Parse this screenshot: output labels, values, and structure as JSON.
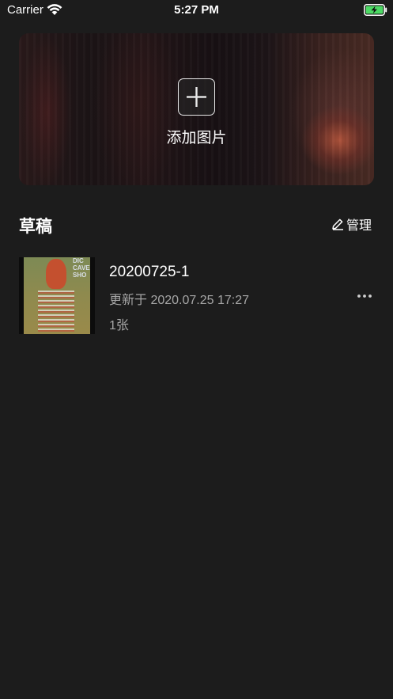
{
  "status_bar": {
    "carrier": "Carrier",
    "time": "5:27 PM",
    "battery_color": "#4cd964"
  },
  "hero": {
    "add_label": "添加图片",
    "add_icon": "plus-icon"
  },
  "drafts_section": {
    "title": "草稿",
    "manage_label": "管理",
    "manage_icon": "pencil-icon"
  },
  "drafts": [
    {
      "name": "20200725-1",
      "updated": "更新于 2020.07.25 17:27",
      "count": "1张",
      "thumbnail_text": "DIC CAVE SHO"
    }
  ],
  "colors": {
    "background": "#1c1c1c",
    "secondary_text": "#a6a6a6"
  }
}
